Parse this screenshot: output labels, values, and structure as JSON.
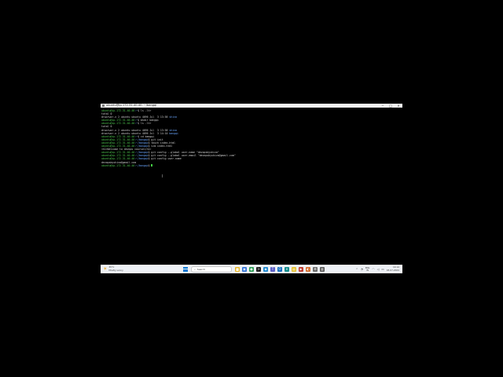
{
  "window": {
    "title": "ubuntu@ip-172-31-40-40: ~/bangqi",
    "minimize": "─",
    "maximize": "□",
    "close": "✕"
  },
  "terminal": {
    "lines": [
      {
        "user": "ubuntu@ip-172-31-40-40",
        "path": ":~",
        "cmd": "$ ls -ltr"
      },
      {
        "text": "total 0"
      },
      {
        "pre": "drwxrwxr-x 2 ubuntu ubuntu 4096 Jul  3 13:58 ",
        "hl": "shiva"
      },
      {
        "user": "ubuntu@ip-172-31-40-40",
        "path": ":~",
        "cmd": "$ mkdir bangqi"
      },
      {
        "user": "ubuntu@ip-172-31-40-40",
        "path": ":~",
        "cmd": "$ ls -ltr"
      },
      {
        "text": "total 0"
      },
      {
        "pre": "drwxrwxr-x 2 ubuntu ubuntu 4096 Jul  3 13:58 ",
        "hl": "shiva"
      },
      {
        "pre": "drwxrwxr-x 2 ubuntu ubuntu 4096 Jul  3 14:10 ",
        "hl": "bangqi"
      },
      {
        "user": "ubuntu@ip-172-31-40-40",
        "path": ":~",
        "cmd": "$ cd bangqi"
      },
      {
        "user": "ubuntu@ip-172-31-40-40",
        "path": ":~/bangqi",
        "cmd": "$ git init"
      },
      {
        "user": "ubuntu@ip-172-31-40-40",
        "path": ":~/bangqi",
        "cmd": "$ touch index.html"
      },
      {
        "user": "ubuntu@ip-172-31-40-40",
        "path": ":~/bangqi",
        "cmd": "$ vim index.html"
      },
      {
        "text": "<h1>Welcome to devops course</h1>"
      },
      {
        "user": "ubuntu@ip-172-31-40-40",
        "path": ":~/bangqi",
        "cmd": "$ git config --global user.name \"devopsbyshiva\""
      },
      {
        "user": "ubuntu@ip-172-31-40-40",
        "path": ":~/bangqi",
        "cmd": "$ git config --global user.email \"devopsbyshiva@gmail.com\""
      },
      {
        "user": "ubuntu@ip-172-31-40-40",
        "path": ":~/bangqi",
        "cmd": "$ git config user.name"
      },
      {
        "text": "devopsbyshiva@gmail.com"
      },
      {
        "user": "ubuntu@ip-172-31-40-40",
        "path": ":~/bangqi",
        "cmd": "$ ",
        "cursor": true
      }
    ]
  },
  "taskbar": {
    "weather_icon": "sun-icon",
    "weather_temp": "35°C",
    "weather_desc": "Mostly sunny",
    "search_placeholder": "Search",
    "apps": [
      {
        "name": "file-explorer-icon",
        "color": "#e8b520",
        "glyph": "▆"
      },
      {
        "name": "store-icon",
        "color": "#2b6fd6",
        "glyph": "▣"
      },
      {
        "name": "chrome-icon",
        "color": "#2a9d52",
        "glyph": "●"
      },
      {
        "name": "terminal-icon",
        "color": "#1e1e1e",
        "glyph": ">"
      },
      {
        "name": "vscode-icon",
        "color": "#1f8ad2",
        "glyph": "◆"
      },
      {
        "name": "teams-icon",
        "color": "#5b5fc7",
        "glyph": "T"
      },
      {
        "name": "outlook-icon",
        "color": "#0f6cbd",
        "glyph": "O"
      },
      {
        "name": "edge-icon",
        "color": "#0c8c8c",
        "glyph": "e"
      },
      {
        "name": "notes-icon",
        "color": "#e5c12a",
        "glyph": "▤"
      },
      {
        "name": "media-icon",
        "color": "#c0392b",
        "glyph": "▶"
      },
      {
        "name": "photos-icon",
        "color": "#d36b2a",
        "glyph": "◐"
      },
      {
        "name": "settings-icon",
        "color": "#6b6b6b",
        "glyph": "⚙"
      },
      {
        "name": "ssh-icon",
        "color": "#555555",
        "glyph": "▥"
      }
    ],
    "lang_top": "ENG",
    "lang_bottom": "IN",
    "time": "14:14",
    "date": "03-07-2024"
  }
}
